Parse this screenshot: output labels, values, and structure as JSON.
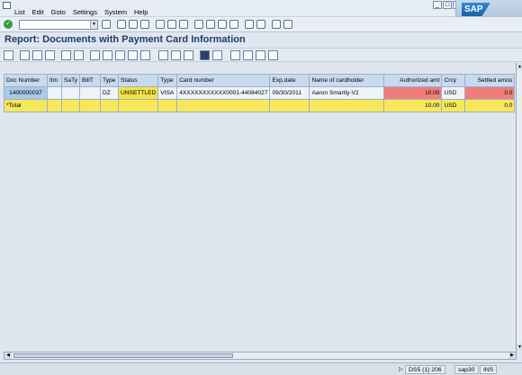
{
  "menu": {
    "items": [
      "List",
      "Edit",
      "Goto",
      "Settings",
      "System",
      "Help"
    ]
  },
  "window_controls": [
    "_",
    "□",
    "×"
  ],
  "brand": {
    "logo_text": "SAP"
  },
  "page": {
    "title": "Report: Documents with Payment Card Information"
  },
  "grid": {
    "columns": [
      {
        "label": "Doc Number",
        "align": "left"
      },
      {
        "label": "Itm",
        "align": "left"
      },
      {
        "label": "SaTy",
        "align": "left"
      },
      {
        "label": "BillT",
        "align": "left"
      },
      {
        "label": "Type",
        "align": "left"
      },
      {
        "label": "Status",
        "align": "left"
      },
      {
        "label": "Type",
        "align": "left"
      },
      {
        "label": "Card number",
        "align": "left"
      },
      {
        "label": "Exp.date",
        "align": "left"
      },
      {
        "label": "Name of cardholder",
        "align": "left"
      },
      {
        "label": "Authorized amt",
        "align": "right"
      },
      {
        "label": "Crcy",
        "align": "left"
      },
      {
        "label": "Settled amou",
        "align": "right"
      }
    ],
    "rows": [
      {
        "doc_number": "1400000037",
        "itm": "",
        "saty": "",
        "billt": "",
        "type": "DZ",
        "status": "UNSETTLED",
        "card_type": "VISA",
        "card_number": "4XXXXXXXXXXX0001-44084027",
        "exp_date": "09/30/2011",
        "cardholder": "Aaron Smartly-V2",
        "authorized_amt": "10.00",
        "crcy": "USD",
        "settled_amt": "0.0"
      }
    ],
    "total": {
      "label": "*Total",
      "authorized_amt": "10.00",
      "crcy": "USD",
      "settled_amt": "0.0"
    }
  },
  "status_bar": {
    "system": "DS5 (1) 206",
    "server": "sap30",
    "mode": "INS"
  },
  "colors": {
    "header_bg": "#c7daf0",
    "key_cell": "#a8cbe8",
    "status_warn": "#f2e34a",
    "amount_red": "#f07d7d",
    "total_row": "#f6e85a",
    "title_text": "#203c66"
  }
}
